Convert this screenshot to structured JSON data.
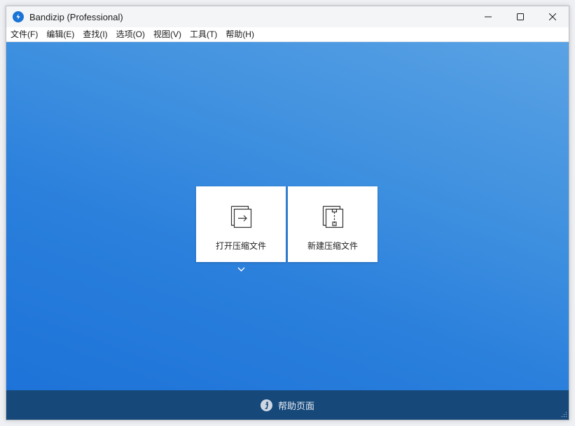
{
  "window": {
    "title": "Bandizip (Professional)"
  },
  "icons": {
    "app": "bandizip-logo-icon",
    "minimize": "minimize-icon",
    "maximize": "maximize-icon",
    "close": "close-icon",
    "open": "open-archive-icon",
    "new": "new-archive-icon",
    "dropdown": "chevron-down-icon",
    "help": "info-icon"
  },
  "menu": {
    "items": [
      {
        "label": "文件(F)",
        "hotkey": "F"
      },
      {
        "label": "编辑(E)",
        "hotkey": "E"
      },
      {
        "label": "查找(I)",
        "hotkey": "I"
      },
      {
        "label": "选项(O)",
        "hotkey": "O"
      },
      {
        "label": "视图(V)",
        "hotkey": "V"
      },
      {
        "label": "工具(T)",
        "hotkey": "T"
      },
      {
        "label": "帮助(H)",
        "hotkey": "H"
      }
    ]
  },
  "actions": {
    "open_label": "打开压缩文件",
    "new_label": "新建压缩文件"
  },
  "footer": {
    "help_label": "帮助页面"
  },
  "colors": {
    "accent": "#1a73d6",
    "footer": "#16487a",
    "background_top": "#5aa2e4",
    "background_bottom": "#1d73d8"
  }
}
